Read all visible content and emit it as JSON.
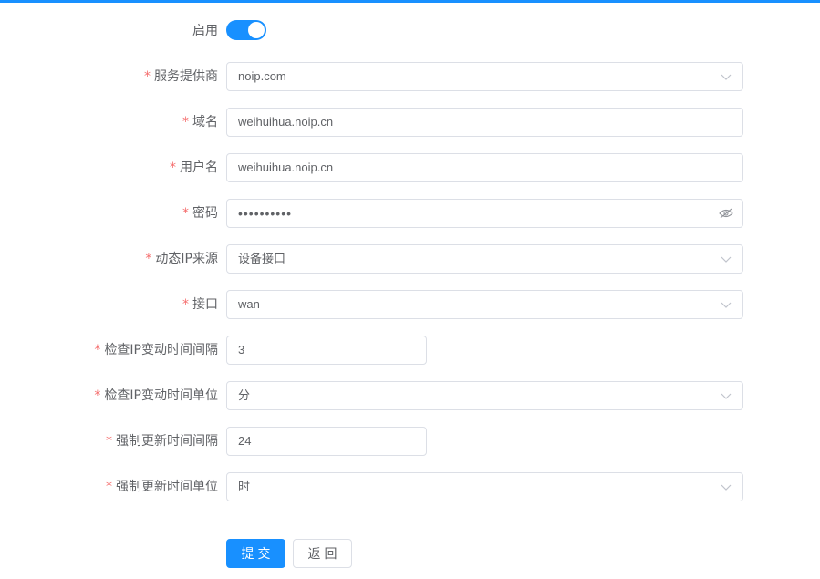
{
  "form": {
    "enable": {
      "label": "启用",
      "on": true
    },
    "provider": {
      "label": "服务提供商",
      "value": "noip.com"
    },
    "domain": {
      "label": "域名",
      "value": "weihuihua.noip.cn"
    },
    "username": {
      "label": "用户名",
      "value": "weihuihua.noip.cn"
    },
    "password": {
      "label": "密码",
      "value": "••••••••••"
    },
    "ip_source": {
      "label": "动态IP来源",
      "value": "设备接口"
    },
    "interface": {
      "label": "接口",
      "value": "wan"
    },
    "check_interval": {
      "label": "检查IP变动时间间隔",
      "value": "3"
    },
    "check_unit": {
      "label": "检查IP变动时间单位",
      "value": "分"
    },
    "force_interval": {
      "label": "强制更新时间间隔",
      "value": "24"
    },
    "force_unit": {
      "label": "强制更新时间单位",
      "value": "时"
    },
    "required_mark": "*"
  },
  "buttons": {
    "submit": "提交",
    "back": "返回"
  },
  "colors": {
    "accent": "#1890ff",
    "required": "#f56c6c",
    "border": "#dcdfe6",
    "text": "#606266"
  },
  "icons": {
    "select": "chevron-down-icon",
    "password": "eye-off-icon"
  }
}
